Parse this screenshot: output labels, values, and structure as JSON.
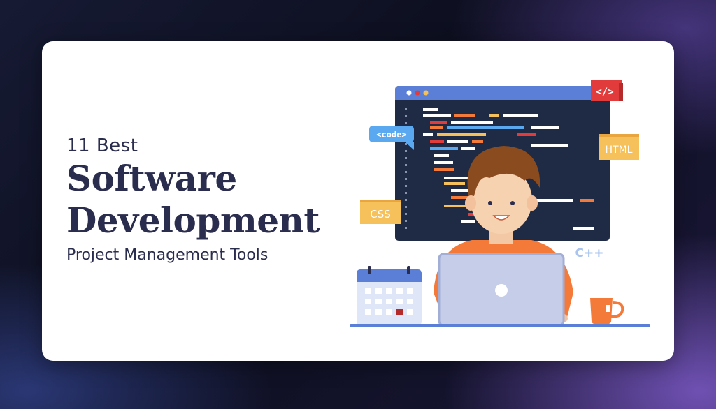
{
  "headline": {
    "kicker": "11 Best",
    "line1": "Software",
    "line2": "Development",
    "subtitle": "Project Management Tools"
  },
  "illustration": {
    "tag_html_symbol": "</>",
    "tag_code": "<code>",
    "tag_html": "HTML",
    "tag_css": "CSS",
    "tag_cpp": "C++"
  },
  "colors": {
    "navy_text": "#2b2d4e",
    "code_window": "#1f2a44",
    "window_bar": "#5b7fd6",
    "accent_red": "#e23b3b",
    "accent_orange": "#f47a3a",
    "tag_yellow": "#f6c15a",
    "tag_blue": "#5aa8f0"
  }
}
